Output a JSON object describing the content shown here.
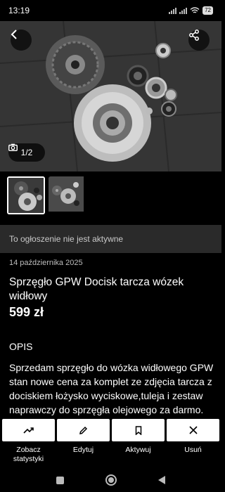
{
  "status_bar": {
    "time": "13:19",
    "battery": "72"
  },
  "gallery": {
    "counter": "1/2",
    "thumbnail_count": 2
  },
  "listing": {
    "inactive_notice": "To ogłoszenie nie jest aktywne",
    "date": "14 października 2025",
    "title": "Sprzęgło GPW Docisk tarcza wózek widłowy",
    "price": "599 zł",
    "section_label": "OPIS",
    "description": "Sprzedam sprzęgło do wózka widłowego GPW stan nowe cena za komplet ze zdjęcia tarcza z dociskiem łożysko wyciskowe,tuleja i zestaw naprawczy do sprzęgła olejowego za darmo."
  },
  "actions": [
    {
      "label": "Zobacz statystyki",
      "icon": "trending-up-icon"
    },
    {
      "label": "Edytuj",
      "icon": "pencil-icon"
    },
    {
      "label": "Aktywuj",
      "icon": "bookmark-icon"
    },
    {
      "label": "Usuń",
      "icon": "close-icon"
    }
  ],
  "colors": {
    "background": "#000000",
    "banner": "#2a2a2a",
    "button": "#ffffff"
  }
}
